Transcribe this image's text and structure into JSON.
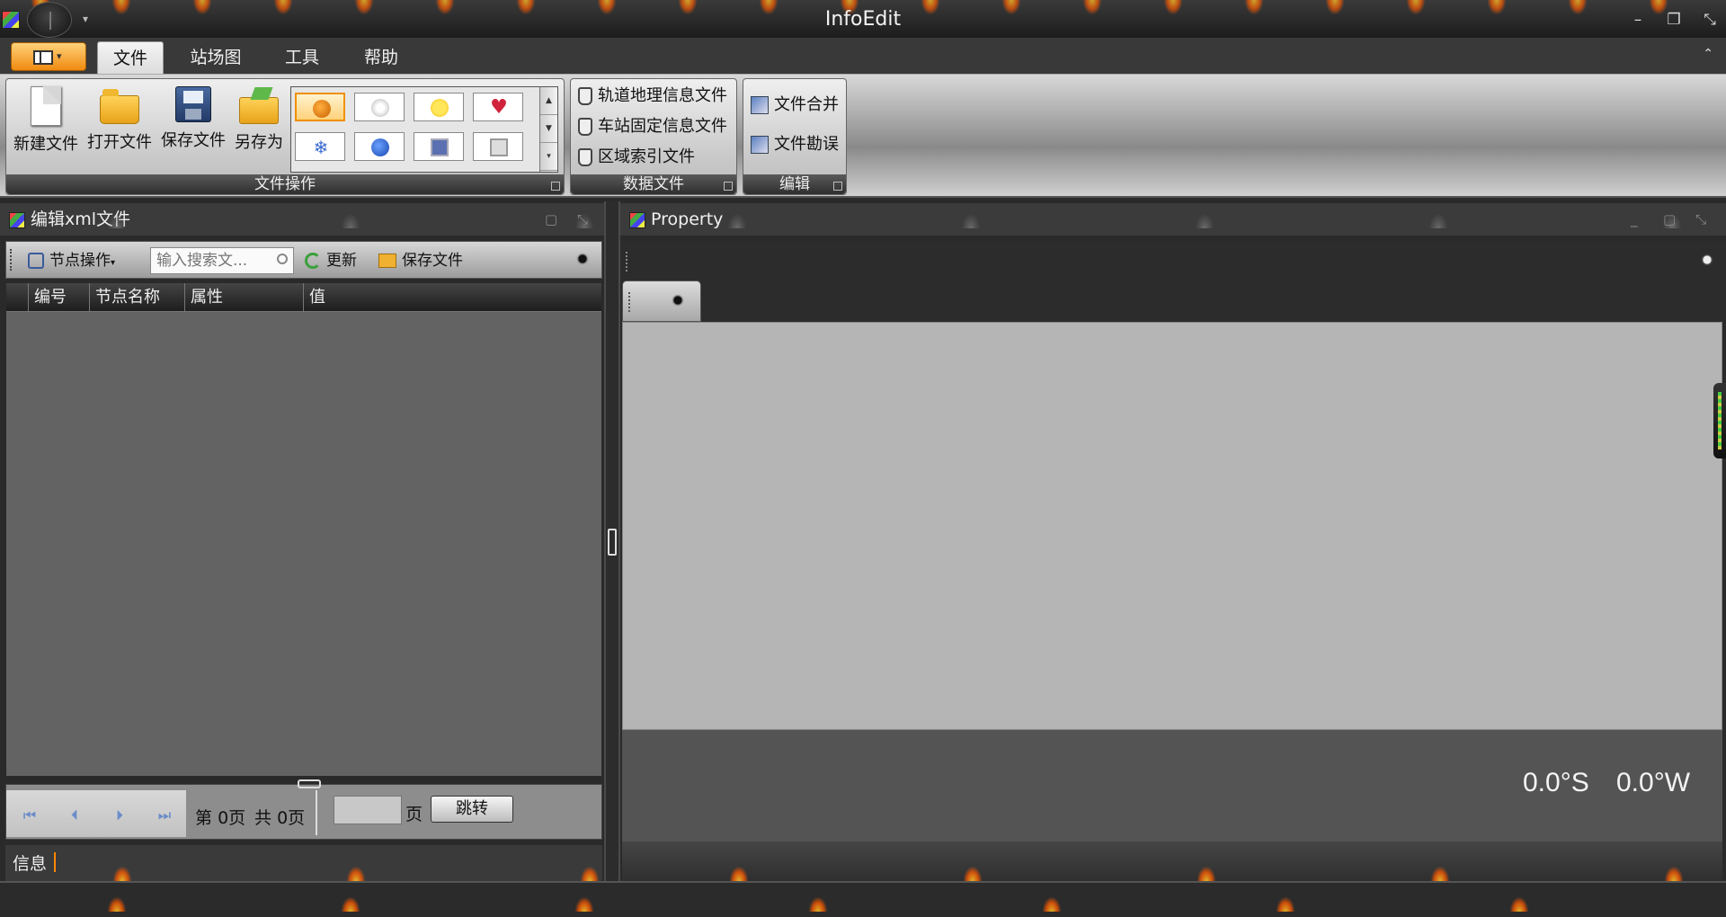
{
  "window": {
    "title": "InfoEdit"
  },
  "ribbon": {
    "tabs": [
      {
        "label": "文件",
        "active": true
      },
      {
        "label": "站场图",
        "active": false
      },
      {
        "label": "工具",
        "active": false
      },
      {
        "label": "帮助",
        "active": false
      }
    ],
    "groups": {
      "file_ops": {
        "label": "文件操作",
        "buttons": [
          "新建文件",
          "打开文件",
          "保存文件",
          "另存为"
        ]
      },
      "data_files": {
        "label": "数据文件",
        "items": [
          "轨道地理信息文件",
          "车站固定信息文件",
          "区域索引文件"
        ]
      },
      "edit": {
        "label": "编辑",
        "items": [
          "文件合并",
          "文件勘误"
        ]
      }
    },
    "gallery_icons": [
      "pumpkin-icon",
      "flower-icon",
      "sun-icon",
      "heart-icon",
      "snowflake-icon",
      "apple-icon",
      "blue-square-icon",
      "gray-square-icon"
    ]
  },
  "left_panel": {
    "title": "编辑xml文件",
    "toolbar": {
      "node_ops": "节点操作",
      "search_placeholder": "输入搜索文...",
      "refresh": "更新",
      "save_file": "保存文件"
    },
    "grid_columns": [
      "编号",
      "节点名称",
      "属性",
      "值"
    ],
    "pager": {
      "page_prefix": "第",
      "current_page": "0页",
      "total_prefix": "共",
      "total_pages": "0页",
      "page_unit": "页",
      "jump": "跳转"
    },
    "status_label": "信息"
  },
  "right_panel": {
    "title": "Property",
    "coords": {
      "lat": "0.0°S",
      "lon": "0.0°W"
    }
  },
  "colors": {
    "accent": "#f08a10",
    "panel_bg": "#636363",
    "canvas_bg": "#b5b5b5"
  }
}
